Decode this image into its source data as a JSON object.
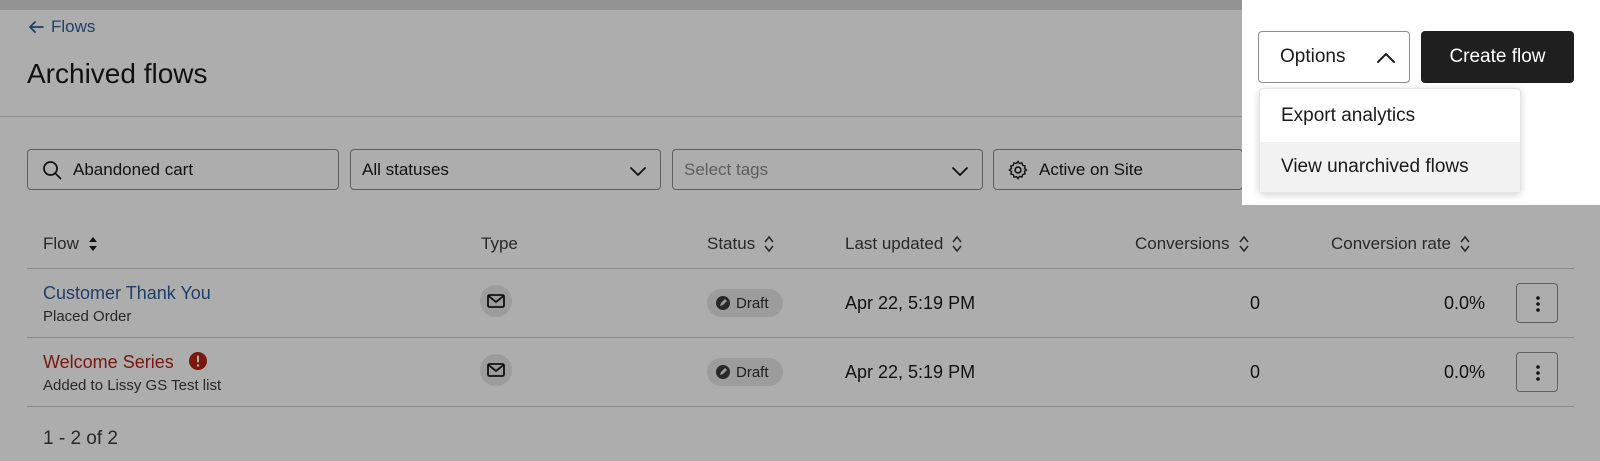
{
  "nav": {
    "back_label": "Flows"
  },
  "page": {
    "title": "Archived flows"
  },
  "actions": {
    "options_label": "Options",
    "create_label": "Create flow",
    "menu": [
      {
        "label": "Export analytics"
      },
      {
        "label": "View unarchived flows"
      }
    ]
  },
  "filters": {
    "search_value": "Abandoned cart",
    "status_value": "All statuses",
    "tags_placeholder": "Select tags",
    "site_value": "Active on Site"
  },
  "table": {
    "columns": [
      "Flow",
      "Type",
      "Status",
      "Last updated",
      "Conversions",
      "Conversion rate"
    ],
    "rows": [
      {
        "name": "Customer Thank You",
        "trigger": "Placed Order",
        "has_error": false,
        "type_icon": "mail-icon",
        "status": "Draft",
        "updated": "Apr 22, 5:19 PM",
        "conversions": "0",
        "rate": "0.0%"
      },
      {
        "name": "Welcome Series",
        "trigger": "Added to Lissy GS Test list",
        "has_error": true,
        "type_icon": "mail-icon",
        "status": "Draft",
        "updated": "Apr 22, 5:19 PM",
        "conversions": "0",
        "rate": "0.0%"
      }
    ]
  },
  "pagination": {
    "label": "1 - 2 of 2"
  },
  "colors": {
    "link": "#2f5d9b",
    "error": "#b42318",
    "primary_button": "#1f1f1f"
  }
}
